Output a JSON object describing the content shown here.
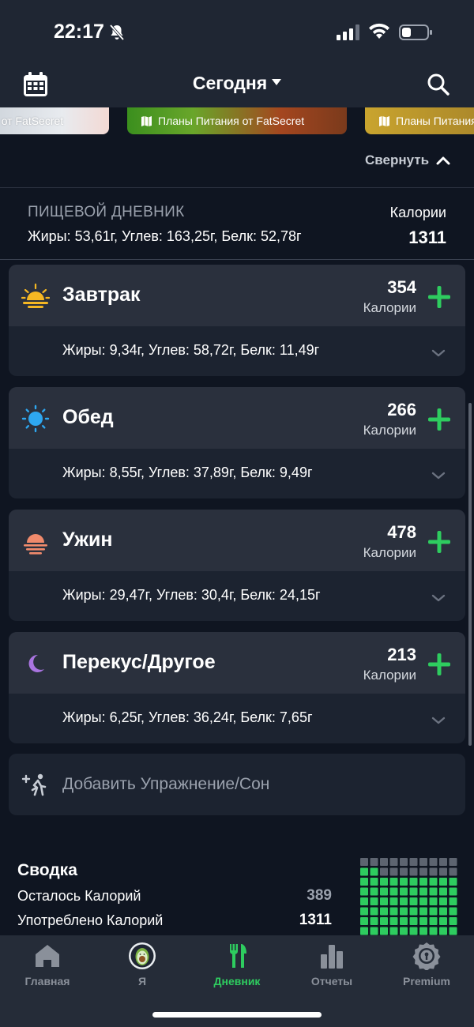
{
  "status_bar": {
    "time": "22:17"
  },
  "header": {
    "title": "Сегодня"
  },
  "banners": [
    {
      "label": "и от FatSecret"
    },
    {
      "label": "Планы Питания от FatSecret"
    },
    {
      "label": "Планы Питания"
    }
  ],
  "collapse_label": "Свернуть",
  "diary": {
    "label": "ПИЩЕВОЙ ДНЕВНИК",
    "macros": "Жиры: 53,61г, Углев: 163,25г, Белк: 52,78г",
    "calories_label": "Калории",
    "calories_value": "1311"
  },
  "meals": [
    {
      "name": "Завтрак",
      "calories": "354",
      "calories_label": "Калории",
      "macros": "Жиры: 9,34г, Углев: 58,72г, Белк: 11,49г",
      "icon": "sunrise-icon"
    },
    {
      "name": "Обед",
      "calories": "266",
      "calories_label": "Калории",
      "macros": "Жиры: 8,55г, Углев: 37,89г, Белк: 9,49г",
      "icon": "sun-icon"
    },
    {
      "name": "Ужин",
      "calories": "478",
      "calories_label": "Калории",
      "macros": "Жиры: 29,47г, Углев: 30,4г, Белк: 24,15г",
      "icon": "sunset-icon"
    },
    {
      "name": "Перекус/Другое",
      "calories": "213",
      "calories_label": "Калории",
      "macros": "Жиры: 6,25г, Углев: 36,24г, Белк: 7,65г",
      "icon": "moon-icon"
    }
  ],
  "add_exercise": "Добавить Упражнение/Сон",
  "summary": {
    "title": "Сводка",
    "rows": [
      {
        "label": "Осталось Калорий",
        "value": "389"
      },
      {
        "label": "Употреблено Калорий",
        "value": "1311"
      }
    ],
    "progress_fraction": 0.77
  },
  "tabs": [
    {
      "label": "Главная",
      "icon": "home-icon"
    },
    {
      "label": "Я",
      "icon": "avatar-icon"
    },
    {
      "label": "Дневник",
      "icon": "fork-knife-icon",
      "active": true
    },
    {
      "label": "Отчеты",
      "icon": "bar-chart-icon"
    },
    {
      "label": "Premium",
      "icon": "premium-badge-icon"
    }
  ],
  "colors": {
    "accent": "#2ecc5f",
    "background": "#0f1521",
    "card": "#1c2330",
    "card_header": "#2a303d",
    "muted_text": "#9aa1ad"
  }
}
